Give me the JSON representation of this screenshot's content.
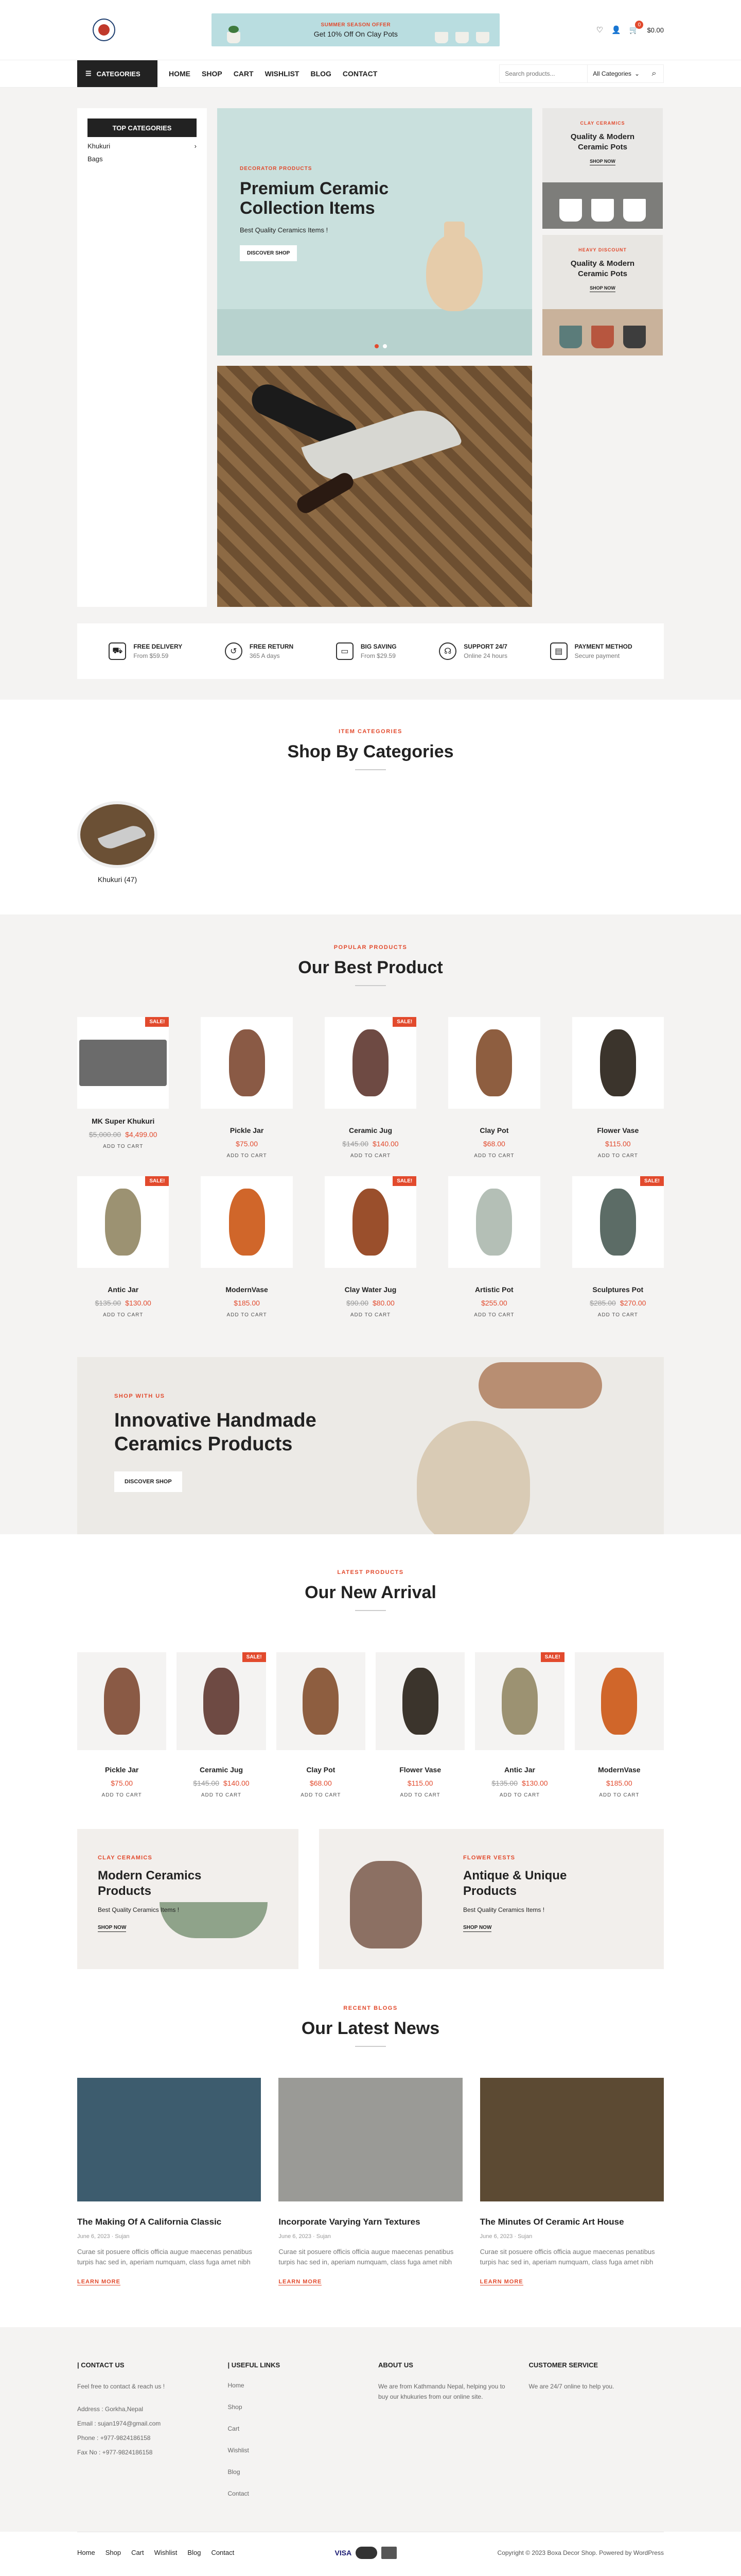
{
  "header": {
    "banner_small": "SUMMER SEASON OFFER",
    "banner_main": "Get 10% Off On Clay Pots",
    "cart_count": "0",
    "cart_total": "$0.00"
  },
  "nav": {
    "categories": "CATEGORIES",
    "items": [
      "HOME",
      "SHOP",
      "CART",
      "WISHLIST",
      "BLOG",
      "CONTACT"
    ],
    "search_placeholder": "Search products...",
    "all_categories": "All Categories"
  },
  "sidebar": {
    "title": "TOP CATEGORIES",
    "items": [
      "Khukuri",
      "Bags"
    ]
  },
  "slider": {
    "sub": "DECORATOR PRODUCTS",
    "title": "Premium Ceramic Collection Items",
    "desc": "Best Quality Ceramics Items !",
    "btn": "DISCOVER SHOP"
  },
  "side_cards": [
    {
      "sub": "CLAY CERAMICS",
      "title": "Quality & Modern Ceramic Pots",
      "btn": "SHOP NOW"
    },
    {
      "sub": "HEAVY DISCOUNT",
      "title": "Quality & Modern Ceramic Pots",
      "btn": "SHOP NOW"
    }
  ],
  "features": [
    {
      "title": "FREE DELIVERY",
      "desc": "From $59.59",
      "icon": "truck-icon"
    },
    {
      "title": "FREE RETURN",
      "desc": "365 A days",
      "icon": "return-icon"
    },
    {
      "title": "BIG SAVING",
      "desc": "From $29.59",
      "icon": "wallet-icon"
    },
    {
      "title": "SUPPORT 24/7",
      "desc": "Online 24 hours",
      "icon": "headset-icon"
    },
    {
      "title": "PAYMENT METHOD",
      "desc": "Secure payment",
      "icon": "card-icon"
    }
  ],
  "categories_section": {
    "sub": "ITEM CATEGORIES",
    "title": "Shop By Categories",
    "item": "Khukuri (47)"
  },
  "best": {
    "sub": "POPULAR PRODUCTS",
    "title": "Our Best Product",
    "products": [
      {
        "name": "MK Super Khukuri",
        "old": "$5,000.00",
        "price": "$4,499.00",
        "sale": "SALE!",
        "color": "#6b6b6b"
      },
      {
        "name": "Pickle Jar",
        "old": "",
        "price": "$75.00",
        "sale": "",
        "color": "#8a5a45"
      },
      {
        "name": "Ceramic Jug",
        "old": "$145.00",
        "price": "$140.00",
        "sale": "SALE!",
        "color": "#6e4a43"
      },
      {
        "name": "Clay Pot",
        "old": "",
        "price": "$68.00",
        "sale": "",
        "color": "#8e5e40"
      },
      {
        "name": "Flower Vase",
        "old": "",
        "price": "$115.00",
        "sale": "",
        "color": "#3b342c"
      },
      {
        "name": "Antic Jar",
        "old": "$135.00",
        "price": "$130.00",
        "sale": "SALE!",
        "color": "#9c9272"
      },
      {
        "name": "ModernVase",
        "old": "",
        "price": "$185.00",
        "sale": "",
        "color": "#d0662a"
      },
      {
        "name": "Clay Water Jug",
        "old": "$90.00",
        "price": "$80.00",
        "sale": "SALE!",
        "color": "#9a4f2c"
      },
      {
        "name": "Artistic Pot",
        "old": "",
        "price": "$255.00",
        "sale": "",
        "color": "#b4bfb6"
      },
      {
        "name": "Sculptures Pot",
        "old": "$285.00",
        "price": "$270.00",
        "sale": "SALE!",
        "color": "#5c6c66"
      }
    ],
    "add_to_cart": "ADD TO CART"
  },
  "banner2": {
    "sub": "SHOP WITH US",
    "title": "Innovative Handmade Ceramics Products",
    "btn": "DISCOVER SHOP"
  },
  "new": {
    "sub": "LATEST PRODUCTS",
    "title": "Our New Arrival",
    "products": [
      {
        "name": "Pickle Jar",
        "old": "",
        "price": "$75.00",
        "sale": "",
        "color": "#8a5a45"
      },
      {
        "name": "Ceramic Jug",
        "old": "$145.00",
        "price": "$140.00",
        "sale": "SALE!",
        "color": "#6e4a43"
      },
      {
        "name": "Clay Pot",
        "old": "",
        "price": "$68.00",
        "sale": "",
        "color": "#8e5e40"
      },
      {
        "name": "Flower Vase",
        "old": "",
        "price": "$115.00",
        "sale": "",
        "color": "#3b342c"
      },
      {
        "name": "Antic Jar",
        "old": "$135.00",
        "price": "$130.00",
        "sale": "SALE!",
        "color": "#9c9272"
      },
      {
        "name": "ModernVase",
        "old": "",
        "price": "$185.00",
        "sale": "",
        "color": "#d0662a"
      }
    ]
  },
  "promos": [
    {
      "sub": "CLAY CERAMICS",
      "title": "Modern Ceramics Products",
      "desc": "Best Quality Ceramics Items !",
      "btn": "SHOP NOW"
    },
    {
      "sub": "FLOWER VESTS",
      "title": "Antique & Unique Products",
      "desc": "Best Quality Ceramics Items !",
      "btn": "SHOP NOW"
    }
  ],
  "blog": {
    "sub": "RECENT BLOGS",
    "title": "Our Latest News",
    "posts": [
      {
        "title": "The Making Of A California Classic",
        "date": "June 6, 2023",
        "author": "Sujan",
        "excerpt": "Curae sit posuere officis officia augue maecenas penatibus turpis hac sed in, aperiam numquam, class fuga amet nibh",
        "more": "LEARN MORE",
        "color": "#3d5c6e"
      },
      {
        "title": "Incorporate Varying Yarn Textures",
        "date": "June 6, 2023",
        "author": "Sujan",
        "excerpt": "Curae sit posuere officis officia augue maecenas penatibus turpis hac sed in, aperiam numquam, class fuga amet nibh",
        "more": "LEARN MORE",
        "color": "#9a9a96"
      },
      {
        "title": "The Minutes Of Ceramic Art House",
        "date": "June 6, 2023",
        "author": "Sujan",
        "excerpt": "Curae sit posuere officis officia augue maecenas penatibus turpis hac sed in, aperiam numquam, class fuga amet nibh",
        "more": "LEARN MORE",
        "color": "#5c4a33"
      }
    ]
  },
  "footer": {
    "contact_title": "CONTACT US",
    "contact_lines": [
      "Feel free to contact & reach us !",
      "Address : Gorkha,Nepal",
      "Email : sujan1974@gmail.com",
      "Phone : +977-9824186158",
      "Fax No : +977-9824186158"
    ],
    "links_title": "USEFUL LINKS",
    "links": [
      "Home",
      "Shop",
      "Cart",
      "Wishlist",
      "Blog",
      "Contact"
    ],
    "about_title": "ABOUT US",
    "about_text": "We are from Kathmandu Nepal, helping you to buy our khukuries from our online site.",
    "service_title": "CUSTOMER SERVICE",
    "service_text": "We are 24/7 online to help you.",
    "bottom_links": [
      "Home",
      "Shop",
      "Cart",
      "Wishlist",
      "Blog",
      "Contact"
    ],
    "pay_visa": "VISA",
    "copyright": "Copyright © 2023 Boxa Decor Shop. Powered by WordPress"
  }
}
